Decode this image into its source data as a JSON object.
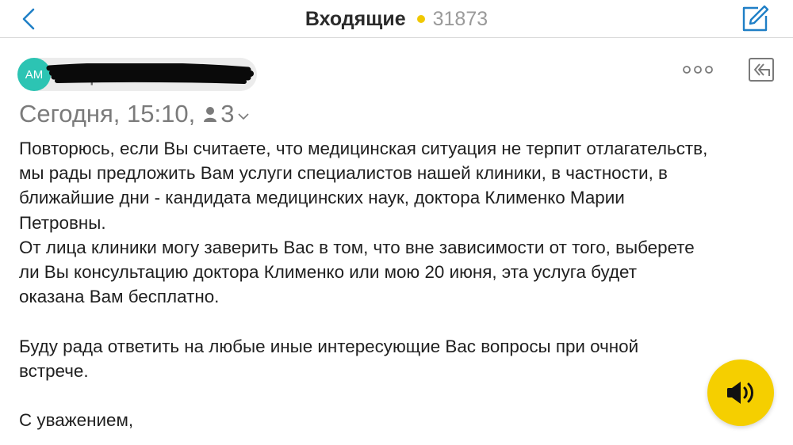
{
  "navbar": {
    "title": "Входящие",
    "unread_count": "31873",
    "unread_dot_color": "#f0c800",
    "accent_color": "#1f7fc6",
    "back_icon": "chevron-left-icon",
    "compose_icon": "compose-icon"
  },
  "message": {
    "sender": {
      "initials": "АМ",
      "avatar_color": "#2cc4b3",
      "name": "Ан          рова",
      "redacted": true
    },
    "actions": {
      "more_icon": "more-dots-icon",
      "reply_all_icon": "reply-all-icon"
    },
    "date": "Сегодня, 15:10,",
    "recipient_count": "3",
    "body": {
      "lines": [
        "Повторюсь, если Вы считаете, что медицинская ситуация не терпит отлагательств,",
        "мы рады предложить Вам услуги специалистов нашей клиники, в частности, в",
        "ближайшие дни - кандидата медицинских наук, доктора Клименко Марии",
        "Петровны.",
        "От лица клиники могу заверить Вас в том, что вне зависимости от того, выберете",
        "ли Вы консультацию доктора Клименко или мою 20 июня, эта услуга будет",
        "оказана Вам бесплатно.",
        "",
        "Буду рада ответить на любые иные интересующие Вас вопросы при очной",
        "встрече.",
        "",
        "С уважением,"
      ]
    }
  },
  "voice_button": {
    "icon": "speaker-icon",
    "color": "#f5cf00"
  }
}
